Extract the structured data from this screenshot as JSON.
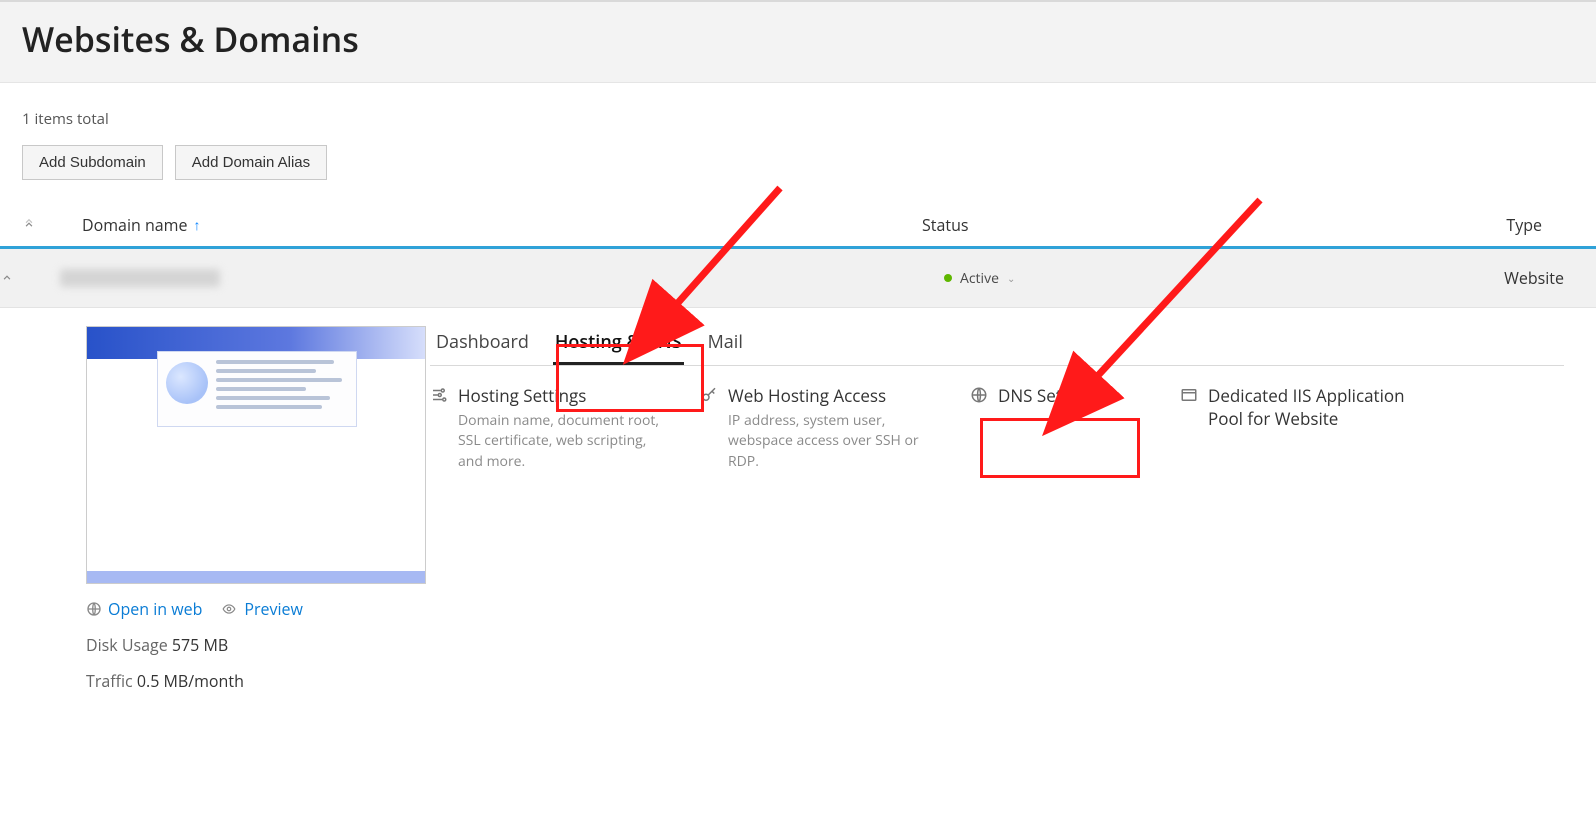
{
  "header": {
    "title": "Websites & Domains"
  },
  "count_text": "1 items total",
  "buttons": {
    "add_subdomain": "Add Subdomain",
    "add_domain_alias": "Add Domain Alias"
  },
  "table": {
    "columns": {
      "domain_name": "Domain name",
      "status": "Status",
      "type": "Type"
    }
  },
  "row": {
    "status_label": "Active",
    "type_label": "Website"
  },
  "preview": {
    "open_in_web": "Open in web",
    "preview": "Preview",
    "disk_usage_label": "Disk Usage",
    "disk_usage_value": "575 MB",
    "traffic_label": "Traffic",
    "traffic_value": "0.5 MB/month"
  },
  "tabs": {
    "dashboard": "Dashboard",
    "hosting_dns": "Hosting & DNS",
    "mail": "Mail"
  },
  "controls": {
    "hosting_settings": {
      "title": "Hosting Settings",
      "desc": "Domain name, document root, SSL certificate, web scripting, and more."
    },
    "web_hosting_access": {
      "title": "Web Hosting Access",
      "desc": "IP address, system user, webspace access over SSH or RDP."
    },
    "dns_settings": {
      "title": "DNS Settings"
    },
    "dedicated_iis": {
      "title": "Dedicated IIS Application Pool for Website"
    }
  }
}
